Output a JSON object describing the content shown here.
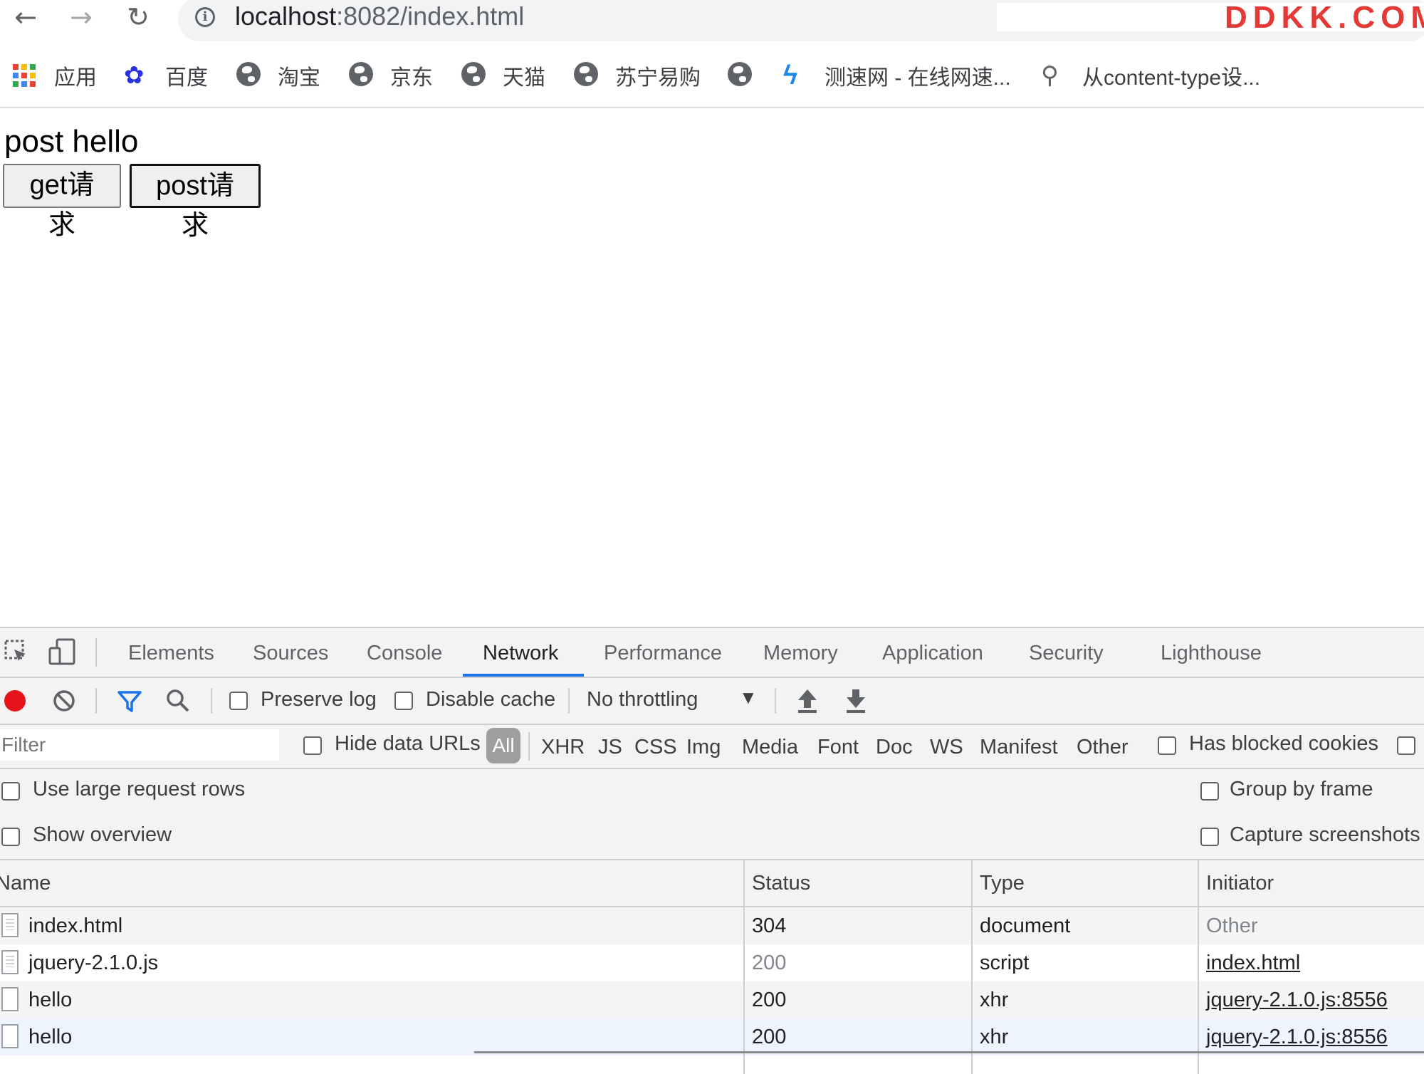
{
  "browser": {
    "back_icon": "←",
    "forward_icon": "→",
    "reload_icon": "↻",
    "info_icon": "i",
    "url_host": "localhost",
    "url_path": ":8082/index.html",
    "watermark": "DDKK.COM"
  },
  "bookmarks": [
    {
      "label": "应用",
      "icon": "apps-icon"
    },
    {
      "label": "百度",
      "icon": "baidu-icon"
    },
    {
      "label": "淘宝",
      "icon": "globe-icon"
    },
    {
      "label": "京东",
      "icon": "globe-icon"
    },
    {
      "label": "天猫",
      "icon": "globe-icon"
    },
    {
      "label": "苏宁易购",
      "icon": "globe-icon"
    },
    {
      "label": "",
      "icon": "globe-icon"
    },
    {
      "label": "测速网 - 在线网速...",
      "icon": "speedtest-icon"
    },
    {
      "label": "从content-type设...",
      "icon": "document-icon"
    }
  ],
  "page": {
    "heading": "post hello",
    "get_button": "get请求",
    "post_button": "post请求"
  },
  "devtools": {
    "tabs": [
      "Elements",
      "Sources",
      "Console",
      "Network",
      "Performance",
      "Memory",
      "Application",
      "Security",
      "Lighthouse"
    ],
    "active_tab": "Network",
    "toolbar": {
      "preserve_log": "Preserve log",
      "disable_cache": "Disable cache",
      "throttling": "No throttling"
    },
    "filter": {
      "placeholder": "Filter",
      "hide_data_urls": "Hide data URLs",
      "types": [
        "All",
        "XHR",
        "JS",
        "CSS",
        "Img",
        "Media",
        "Font",
        "Doc",
        "WS",
        "Manifest",
        "Other"
      ],
      "has_blocked_cookies": "Has blocked cookies"
    },
    "options": {
      "use_large_rows": "Use large request rows",
      "show_overview": "Show overview",
      "group_by_frame": "Group by frame",
      "capture_screenshots": "Capture screenshots"
    },
    "table": {
      "headers": [
        "Name",
        "Status",
        "Type",
        "Initiator"
      ],
      "rows": [
        {
          "name": "index.html",
          "status": "304",
          "type": "document",
          "initiator": "Other"
        },
        {
          "name": "jquery-2.1.0.js",
          "status": "200",
          "type": "script",
          "initiator": "index.html"
        },
        {
          "name": "hello",
          "status": "200",
          "type": "xhr",
          "initiator": "jquery-2.1.0.js:8556"
        },
        {
          "name": "hello",
          "status": "200",
          "type": "xhr",
          "initiator": "jquery-2.1.0.js:8556"
        }
      ]
    }
  },
  "colors": {
    "accent": "#1a73e8",
    "record": "#e8131a",
    "filter_icon": "#1a73e8",
    "watermark": "#e53935"
  }
}
